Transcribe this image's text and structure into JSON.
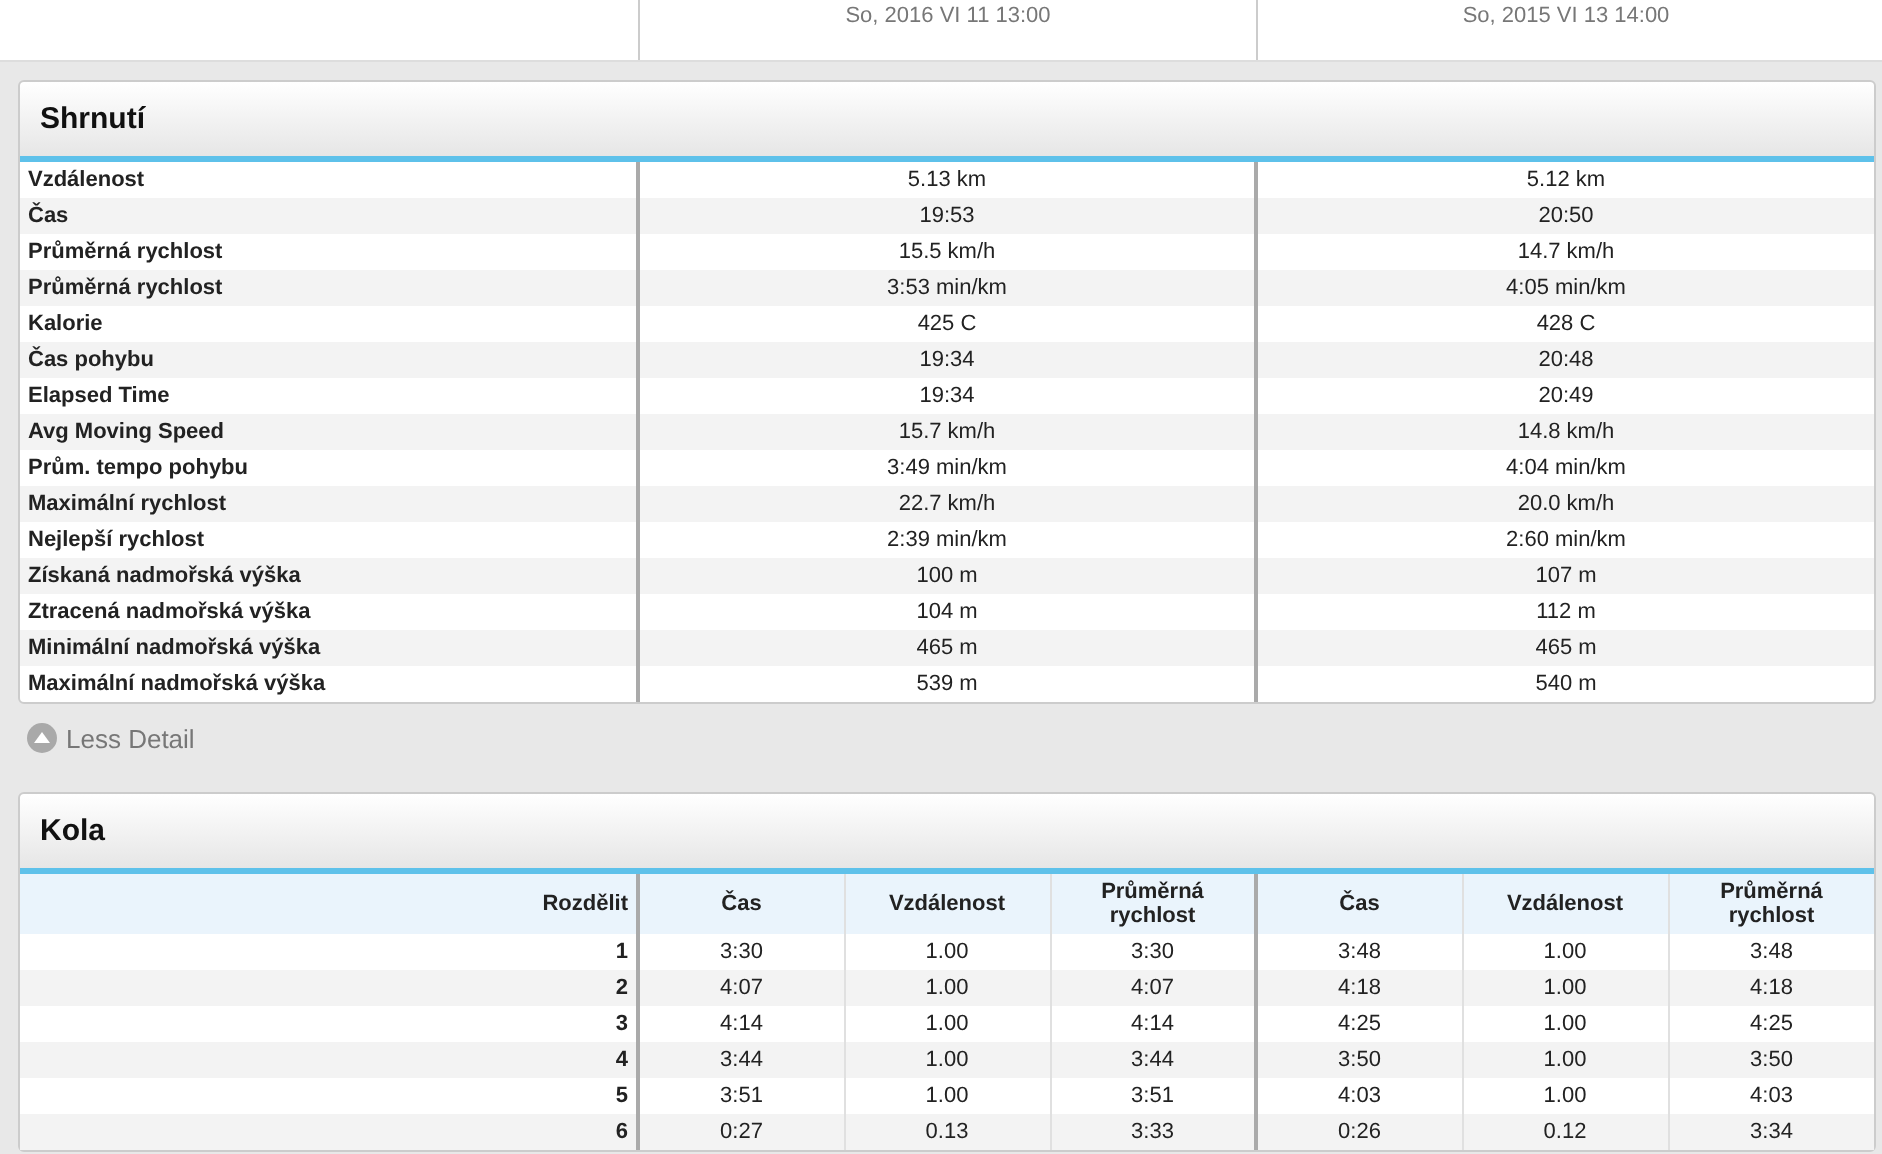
{
  "compare_header": {
    "columns": [
      "So, 2016 VI 11 13:00",
      "So, 2015 VI 13 14:00"
    ]
  },
  "summary": {
    "title": "Shrnutí",
    "rows": [
      {
        "label": "Vzdálenost",
        "values": [
          "5.13 km",
          "5.12 km"
        ]
      },
      {
        "label": "Čas",
        "values": [
          "19:53",
          "20:50"
        ]
      },
      {
        "label": "Průměrná rychlost",
        "values": [
          "15.5 km/h",
          "14.7 km/h"
        ]
      },
      {
        "label": "Průměrná rychlost",
        "values": [
          "3:53 min/km",
          "4:05 min/km"
        ]
      },
      {
        "label": "Kalorie",
        "values": [
          "425 C",
          "428 C"
        ]
      },
      {
        "label": "Čas pohybu",
        "values": [
          "19:34",
          "20:48"
        ]
      },
      {
        "label": "Elapsed Time",
        "values": [
          "19:34",
          "20:49"
        ]
      },
      {
        "label": "Avg Moving Speed",
        "values": [
          "15.7 km/h",
          "14.8 km/h"
        ]
      },
      {
        "label": "Prům. tempo pohybu",
        "values": [
          "3:49 min/km",
          "4:04 min/km"
        ]
      },
      {
        "label": "Maximální rychlost",
        "values": [
          "22.7 km/h",
          "20.0 km/h"
        ]
      },
      {
        "label": "Nejlepší rychlost",
        "values": [
          "2:39 min/km",
          "2:60 min/km"
        ]
      },
      {
        "label": "Získaná nadmořská výška",
        "values": [
          "100 m",
          "107 m"
        ]
      },
      {
        "label": "Ztracená nadmořská výška",
        "values": [
          "104 m",
          "112 m"
        ]
      },
      {
        "label": "Minimální nadmořská výška",
        "values": [
          "465 m",
          "465 m"
        ]
      },
      {
        "label": "Maximální nadmořská výška",
        "values": [
          "539 m",
          "540 m"
        ]
      }
    ]
  },
  "detail_toggle": {
    "label": "Less Detail",
    "expanded": true
  },
  "laps": {
    "title": "Kola",
    "columns": [
      "Rozdělit",
      "Čas",
      "Vzdálenost",
      "Průměrná rychlost",
      "Čas",
      "Vzdálenost",
      "Průměrná rychlost"
    ],
    "rows": [
      [
        "1",
        "3:30",
        "1.00",
        "3:30",
        "3:48",
        "1.00",
        "3:48"
      ],
      [
        "2",
        "4:07",
        "1.00",
        "4:07",
        "4:18",
        "1.00",
        "4:18"
      ],
      [
        "3",
        "4:14",
        "1.00",
        "4:14",
        "4:25",
        "1.00",
        "4:25"
      ],
      [
        "4",
        "3:44",
        "1.00",
        "3:44",
        "3:50",
        "1.00",
        "3:50"
      ],
      [
        "5",
        "3:51",
        "1.00",
        "3:51",
        "4:03",
        "1.00",
        "4:03"
      ],
      [
        "6",
        "0:27",
        "0.13",
        "3:33",
        "0:26",
        "0.12",
        "3:34"
      ]
    ]
  }
}
